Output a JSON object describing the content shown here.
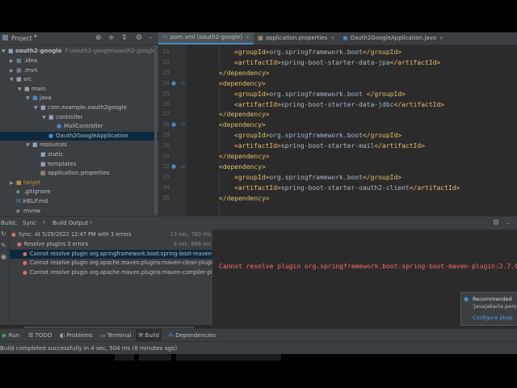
{
  "project_panel": {
    "title": "Project",
    "root_name": "oauth2-google",
    "root_path": "F:\\oauth2-google\\oauth2-google",
    "tree": [
      {
        "label": ".idea",
        "depth": 1,
        "arrow": "▶",
        "kind": "folder-dk"
      },
      {
        "label": ".mvn",
        "depth": 1,
        "arrow": "▶",
        "kind": "folder-dk"
      },
      {
        "label": "src",
        "depth": 1,
        "arrow": "▼",
        "kind": "folder"
      },
      {
        "label": "main",
        "depth": 2,
        "arrow": "▼",
        "kind": "folder"
      },
      {
        "label": "java",
        "depth": 3,
        "arrow": "▼",
        "kind": "folder-blue"
      },
      {
        "label": "com.example.oauth2google",
        "depth": 4,
        "arrow": "▼",
        "kind": "package"
      },
      {
        "label": "controller",
        "depth": 5,
        "arrow": "▼",
        "kind": "package"
      },
      {
        "label": "MailController",
        "depth": 6,
        "arrow": "",
        "kind": "class"
      },
      {
        "label": "Oauth2GoogleApplication",
        "depth": 5,
        "arrow": "",
        "kind": "class",
        "selected": true
      },
      {
        "label": "resources",
        "depth": 3,
        "arrow": "▼",
        "kind": "folder"
      },
      {
        "label": "static",
        "depth": 4,
        "arrow": "",
        "kind": "folder"
      },
      {
        "label": "templates",
        "depth": 4,
        "arrow": "",
        "kind": "folder"
      },
      {
        "label": "application.properties",
        "depth": 4,
        "arrow": "",
        "kind": "props"
      },
      {
        "label": "target",
        "depth": 1,
        "arrow": "▶",
        "kind": "folder-orange"
      },
      {
        "label": ".gitignore",
        "depth": 1,
        "arrow": "",
        "kind": "file"
      },
      {
        "label": "HELP.md",
        "depth": 1,
        "arrow": "",
        "kind": "md"
      },
      {
        "label": "mvnw",
        "depth": 1,
        "arrow": "",
        "kind": "file"
      }
    ]
  },
  "tabs": [
    {
      "label": "pom.xml (oauth2-google)",
      "icon": "m",
      "active": true
    },
    {
      "label": "application.properties",
      "icon": "▦",
      "active": false
    },
    {
      "label": "Oauth2GoogleApplication.java",
      "icon": "●",
      "active": false
    }
  ],
  "editor": {
    "lines": [
      {
        "n": "21",
        "indent": 2,
        "tag_open": "<groupId>",
        "text": "org.springframework.boot",
        "tag_close": "</groupId>"
      },
      {
        "n": "22",
        "indent": 2,
        "tag_open": "<artifactId>",
        "text": "spring-boot-starter-data-jpa",
        "tag_close": "</artifactId>"
      },
      {
        "n": "23",
        "indent": 1,
        "tag_open": "</dependency>",
        "text": "",
        "tag_close": ""
      },
      {
        "n": "24",
        "indent": 1,
        "tag_open": "<dependency>",
        "text": "",
        "tag_close": "",
        "marker": true
      },
      {
        "n": "25",
        "indent": 2,
        "tag_open": "<groupId>",
        "text": "org.springframework.boot ",
        "tag_close": "</groupId>"
      },
      {
        "n": "26",
        "indent": 2,
        "tag_open": "<artifactId>",
        "text": "spring-boot-starter-data-jdbc",
        "tag_close": "</artifactId>"
      },
      {
        "n": "27",
        "indent": 1,
        "tag_open": "</dependency>",
        "text": "",
        "tag_close": ""
      },
      {
        "n": "28",
        "indent": 1,
        "tag_open": "<dependency>",
        "text": "",
        "tag_close": "",
        "marker": true
      },
      {
        "n": "29",
        "indent": 2,
        "tag_open": "<groupId>",
        "text": "org.springframework.boot",
        "tag_close": "</groupId>"
      },
      {
        "n": "30",
        "indent": 2,
        "tag_open": "<artifactId>",
        "text": "spring-boot-starter-mail",
        "tag_close": "</artifactId>"
      },
      {
        "n": "31",
        "indent": 1,
        "tag_open": "</dependency>",
        "text": "",
        "tag_close": ""
      },
      {
        "n": "32",
        "indent": 1,
        "tag_open": "<dependency>",
        "text": "",
        "tag_close": "",
        "marker": true
      },
      {
        "n": "33",
        "indent": 2,
        "tag_open": "<groupId>",
        "text": "org.springframework.boot",
        "tag_close": "</groupId>"
      },
      {
        "n": "34",
        "indent": 2,
        "tag_open": "<artifactId>",
        "text": "spring-boot-starter-oauth2-client",
        "tag_close": "</artifactId>"
      },
      {
        "n": "35",
        "indent": 1,
        "tag_open": "</dependency>",
        "text": "",
        "tag_close": ""
      }
    ],
    "breadcrumb": [
      "project",
      "dependencies"
    ]
  },
  "build": {
    "label": "Build:",
    "tabs": [
      "Sync",
      "Build Output"
    ],
    "rows": [
      {
        "text": "Sync: At 5/29/2022 12:47 PM with 3 errors",
        "time": "13 sec, 780 ms",
        "level": 0,
        "icon": "err"
      },
      {
        "text": "Resolve plugins  3 errors",
        "time": "8 sec, 886 ms",
        "level": 1,
        "icon": "err"
      },
      {
        "text": "Cannot resolve plugin org.springframework.boot:spring-boot-maven-plu",
        "time": "",
        "level": 2,
        "icon": "err",
        "selected": true
      },
      {
        "text": "Cannot resolve plugin org.apache.maven.plugins:maven-clean-plugin:3.2",
        "time": "",
        "level": 2,
        "icon": "err"
      },
      {
        "text": "Cannot resolve plugin org.apache.maven.plugins:maven-compiler-plugi",
        "time": "",
        "level": 2,
        "icon": "err"
      }
    ],
    "error_message": "Cannot resolve plugin org.springframework.boot:spring-boot-maven-plugin:2.7.0",
    "notification": {
      "line1": "Recommended",
      "line2": "'javajakarta.pers",
      "link": "Configure plugi"
    }
  },
  "toolwindows": [
    "Run",
    "TODO",
    "Problems",
    "Terminal",
    "Build",
    "Dependencies"
  ],
  "status": "Build completed successfully in 4 sec, 504 ms (8 minutes ago)"
}
